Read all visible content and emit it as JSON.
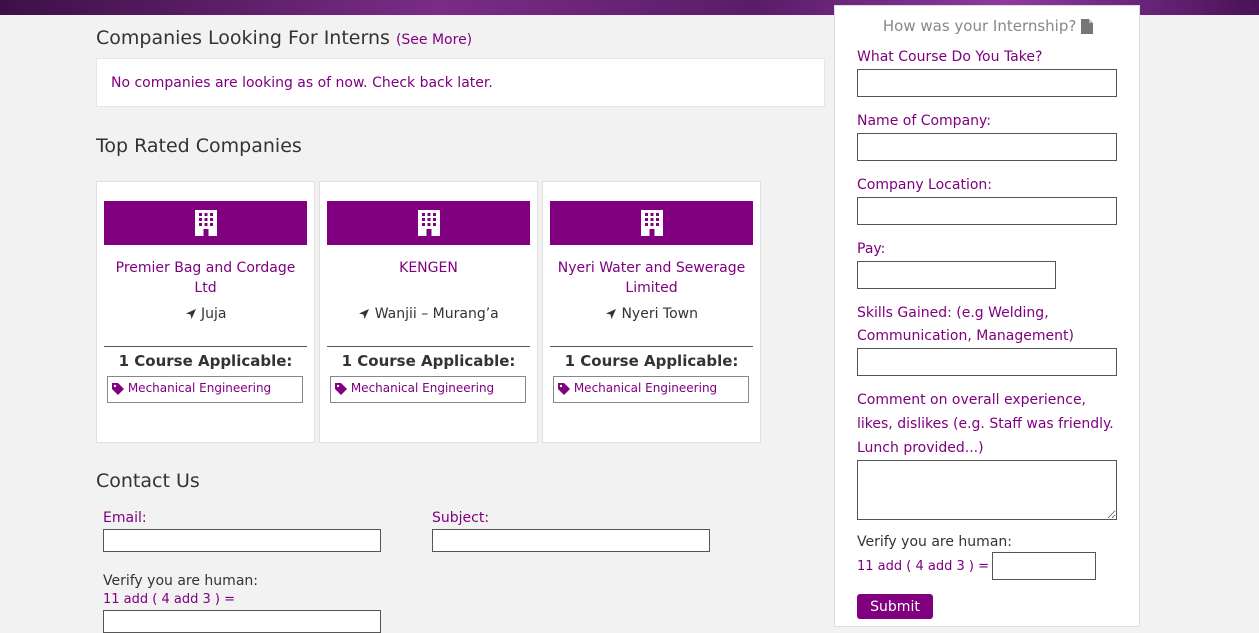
{
  "interns": {
    "title": "Companies Looking For Interns",
    "see_more": "(See More)",
    "notice": "No companies are looking as of now. Check back later."
  },
  "top_rated": {
    "title": "Top Rated Companies",
    "cards": [
      {
        "name": "Premier Bag and Cordage Ltd",
        "location": "Juja",
        "courses_title": "1 Course Applicable:",
        "course": "Mechanical Engineering"
      },
      {
        "name": "KENGEN",
        "location": "Wanjii – Murang’a",
        "courses_title": "1 Course Applicable:",
        "course": "Mechanical Engineering"
      },
      {
        "name": "Nyeri Water and Sewerage Limited",
        "location": "Nyeri Town",
        "courses_title": "1 Course Applicable:",
        "course": "Mechanical Engineering"
      }
    ]
  },
  "contact": {
    "title": "Contact Us",
    "email_label": "Email:",
    "subject_label": "Subject:",
    "verify_label": "Verify you are human:",
    "captcha": "11 add ( 4 add 3 ) ="
  },
  "sidebar": {
    "title": "How was your Internship?",
    "course_label": "What Course Do You Take?",
    "company_label": "Name of Company:",
    "location_label": "Company Location:",
    "pay_label": "Pay:",
    "skills_label": "Skills Gained: (e.g Welding, Communication, Management)",
    "comment_label": "Comment on overall experience, likes, dislikes (e.g. Staff was friendly. Lunch provided...)",
    "verify_label": "Verify you are human:",
    "captcha": "11 add ( 4 add 3 ) =",
    "submit": "Submit"
  },
  "colors": {
    "accent": "#800080",
    "background": "#f2f2f2"
  },
  "icons": {
    "card": "building-icon",
    "location": "location-arrow-icon",
    "tag": "tag-icon",
    "doc": "document-icon"
  }
}
